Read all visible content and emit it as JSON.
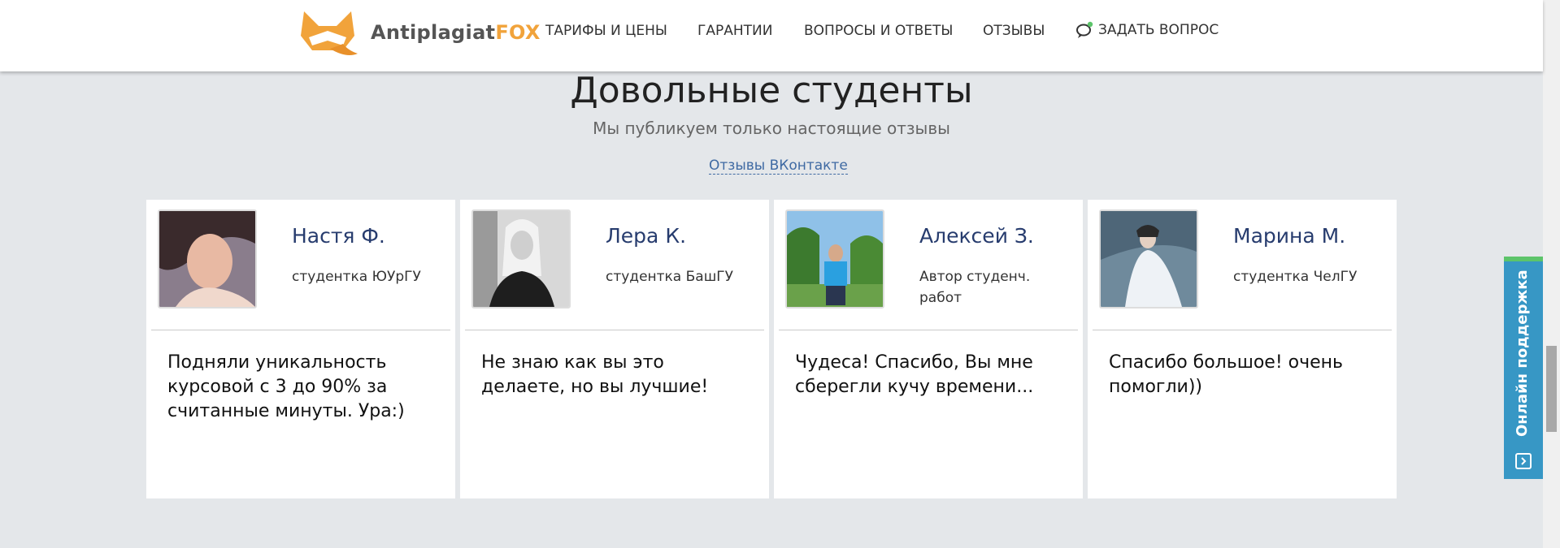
{
  "header": {
    "brand_main": "Antiplagiat",
    "brand_accent": "FOX",
    "nav": [
      "ТАРИФЫ И ЦЕНЫ",
      "ГАРАНТИИ",
      "ВОПРОСЫ И ОТВЕТЫ",
      "ОТЗЫВЫ"
    ],
    "ask": "ЗАДАТЬ ВОПРОС"
  },
  "section": {
    "title": "Довольные студенты",
    "subtitle": "Мы публикуем только настоящие отзывы",
    "vk_link": "Отзывы ВКонтакте"
  },
  "reviews": [
    {
      "name": "Настя Ф.",
      "role": "студентка ЮУрГУ",
      "text": "Подняли уникальность курсовой с 3 до 90% за считанные минуты. Ура:)"
    },
    {
      "name": "Лера К.",
      "role": "студентка БашГУ",
      "text": "Не знаю как вы это делаете, но вы лучшие!"
    },
    {
      "name": "Алексей З.",
      "role": "Автор студенч. работ",
      "text": "Чудеса! Спасибо, Вы мне сберегли кучу времени..."
    },
    {
      "name": "Марина М.",
      "role": "студентка ЧелГУ",
      "text": "Спасибо большое! очень помогли))"
    }
  ],
  "support": {
    "label": "Онлайн поддержка"
  },
  "colors": {
    "brand_orange": "#f1a33b",
    "name_blue": "#273c6e",
    "link_blue": "#3f6aa3",
    "support_blue": "#3797c5",
    "support_green": "#5cc46a"
  }
}
